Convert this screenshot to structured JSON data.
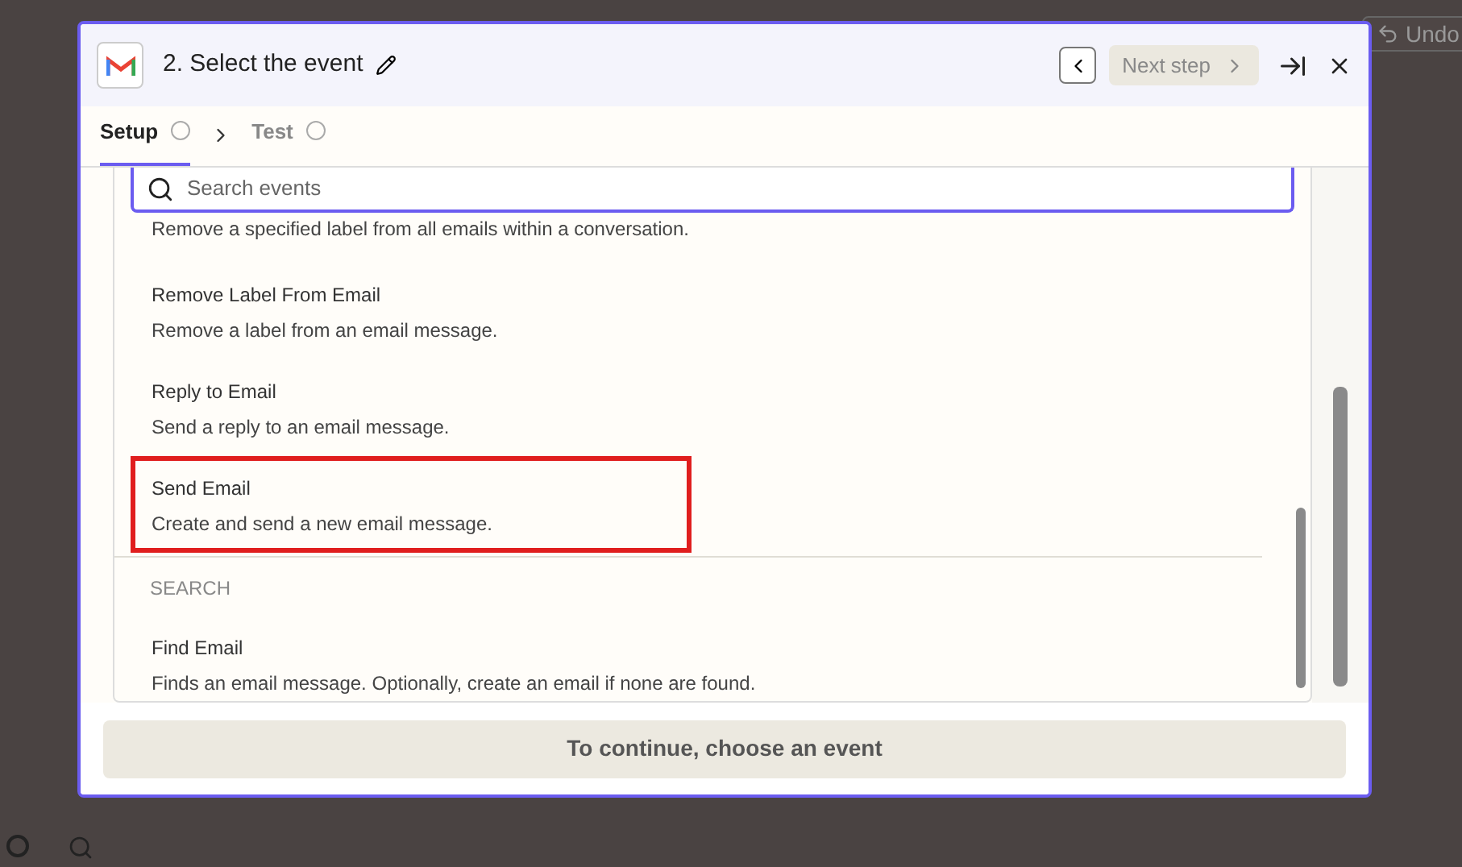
{
  "background": {
    "undo_label": "Undo"
  },
  "modal": {
    "title": "2. Select the event",
    "next_label": "Next step",
    "tabs": [
      {
        "label": "Setup",
        "selected": true
      },
      {
        "label": "Test",
        "selected": false
      }
    ],
    "search": {
      "placeholder": "Search events"
    },
    "groups": [
      {
        "events": [
          {
            "description": "Remove a specified label from all emails within a conversation.",
            "highlighted": false
          },
          {
            "name": "Remove Label From Email",
            "description": "Remove a label from an email message.",
            "highlighted": false
          },
          {
            "name": "Reply to Email",
            "description": "Send a reply to an email message.",
            "highlighted": false
          },
          {
            "name": "Send Email",
            "description": "Create and send a new email message.",
            "highlighted": true
          }
        ]
      },
      {
        "heading": "SEARCH",
        "events": [
          {
            "name": "Find Email",
            "description": "Finds an email message. Optionally, create an email if none are found.",
            "highlighted": false
          }
        ]
      }
    ],
    "continue_label": "To continue, choose an event"
  }
}
